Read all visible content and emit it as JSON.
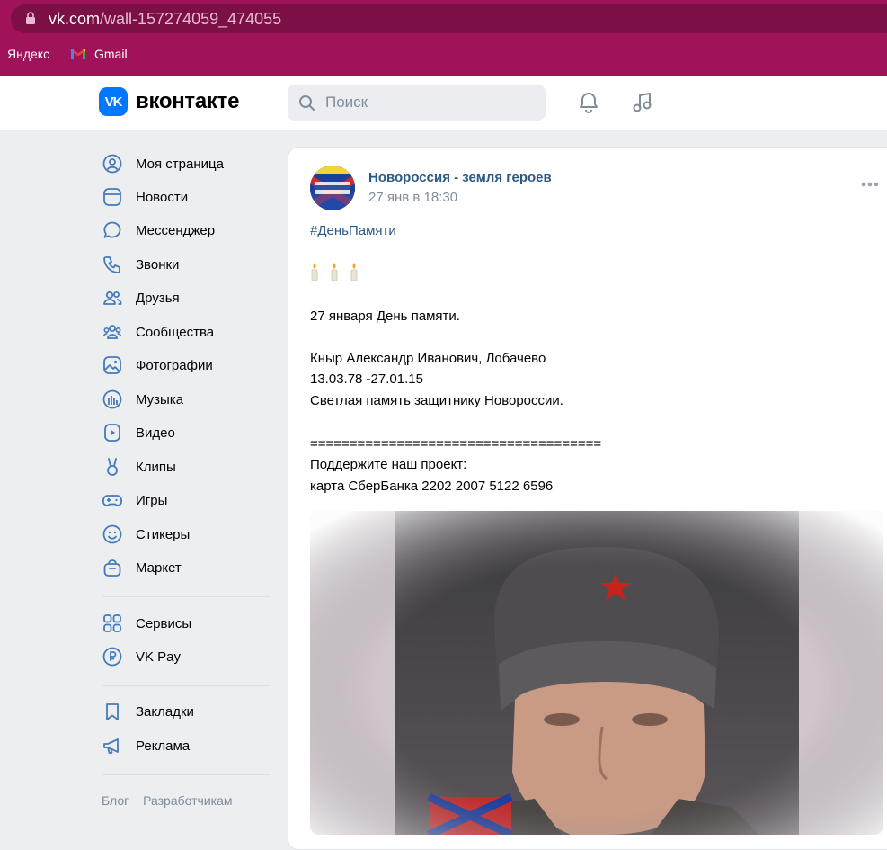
{
  "browser": {
    "url_domain": "vk.com",
    "url_path": "/wall-157274059_474055",
    "bookmarks": [
      {
        "label": "Яндекс"
      },
      {
        "label": "Gmail"
      }
    ]
  },
  "header": {
    "logo_text": "вконтакте",
    "search_placeholder": "Поиск"
  },
  "sidebar": {
    "items": [
      {
        "label": "Моя страница",
        "icon": "profile-icon"
      },
      {
        "label": "Новости",
        "icon": "news-icon"
      },
      {
        "label": "Мессенджер",
        "icon": "messenger-icon"
      },
      {
        "label": "Звонки",
        "icon": "phone-icon"
      },
      {
        "label": "Друзья",
        "icon": "friends-icon"
      },
      {
        "label": "Сообщества",
        "icon": "communities-icon"
      },
      {
        "label": "Фотографии",
        "icon": "photos-icon"
      },
      {
        "label": "Музыка",
        "icon": "music-icon"
      },
      {
        "label": "Видео",
        "icon": "video-icon"
      },
      {
        "label": "Клипы",
        "icon": "clips-icon"
      },
      {
        "label": "Игры",
        "icon": "gamepad-icon"
      },
      {
        "label": "Стикеры",
        "icon": "stickers-icon"
      },
      {
        "label": "Маркет",
        "icon": "market-icon"
      }
    ],
    "items2": [
      {
        "label": "Сервисы",
        "icon": "services-icon"
      },
      {
        "label": "VK Pay",
        "icon": "vkpay-icon"
      }
    ],
    "items3": [
      {
        "label": "Закладки",
        "icon": "bookmark-icon"
      },
      {
        "label": "Реклама",
        "icon": "megaphone-icon"
      }
    ],
    "footer": [
      "Блог",
      "Разработчикам"
    ]
  },
  "post": {
    "author": "Новороссия - земля героев",
    "date": "27 янв в 18:30",
    "hashtag": "#ДеньПамяти",
    "lines": [
      "27 января День памяти.",
      "",
      "Кныр Александр Иванович, Лобачево",
      "13.03.78 -27.01.15",
      "Светлая память защитнику Новороссии.",
      "",
      "=====================================",
      "Поддержите наш проект:",
      "карта СберБанка 2202 2007 5122 6596"
    ]
  },
  "colors": {
    "browser_bar": "#a0135a",
    "vk_blue": "#0077ff",
    "link": "#2a5885",
    "muted": "#818c99",
    "page_bg": "#edeef0"
  }
}
